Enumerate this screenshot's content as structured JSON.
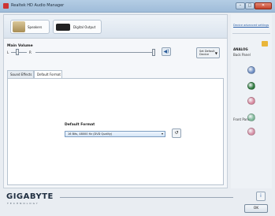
{
  "window": {
    "title": "Realtek HD Audio Manager",
    "minimize": "–",
    "maximize": "□",
    "close": "✕"
  },
  "device_tabs": [
    {
      "label": "Speakers"
    },
    {
      "label": "Digital Output"
    }
  ],
  "volume": {
    "label": "Main Volume",
    "left": "L",
    "right": "R",
    "mute_icon": "speaker-icon",
    "set_default_label": "Set Default Device",
    "level": 1.0
  },
  "sub_tabs": [
    {
      "label": "Sound Effects"
    },
    {
      "label": "Default Format"
    }
  ],
  "default_format": {
    "label": "Default Format",
    "value": "16 Bits, 48000 Hz (DVD Quality)"
  },
  "side": {
    "advanced_link": "Device advanced settings",
    "analog_title": "ANALOG",
    "back_panel": "Back Panel",
    "front_panel": "Front Panel",
    "jack_colors": {
      "back_blue": "#6f8fc4",
      "back_green": "#2f7a3f",
      "back_pink": "#d88aa0",
      "front_green": "#7fb99a",
      "front_pink": "#d690a6"
    }
  },
  "footer": {
    "brand": "GIGABYTE",
    "brand_sub": "TECHNOLOGY",
    "info": "i",
    "ok": "OK"
  }
}
